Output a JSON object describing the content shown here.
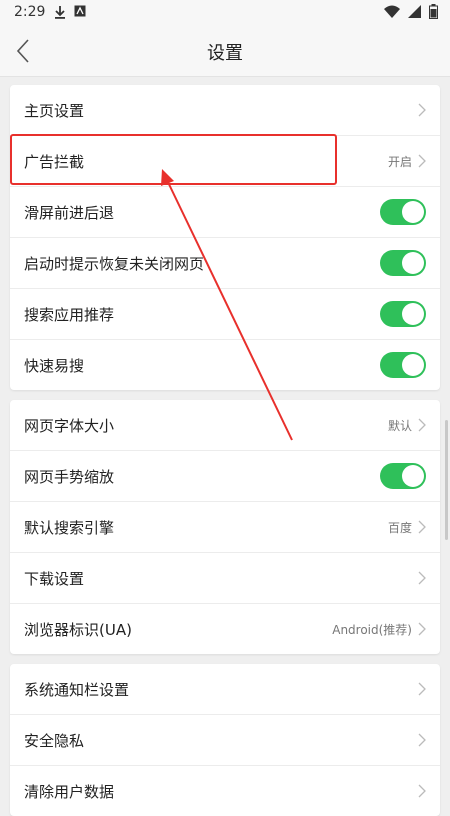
{
  "status_bar": {
    "time": "2:29",
    "left_icons": [
      "download-icon",
      "app-notification-icon"
    ],
    "right_icons": [
      "wifi-icon",
      "signal-icon",
      "battery-icon"
    ]
  },
  "header": {
    "title": "设置",
    "back_icon": "chevron-left-icon"
  },
  "sections": [
    {
      "rows": [
        {
          "name": "homepage-settings",
          "label": "主页设置",
          "type": "link",
          "value": ""
        },
        {
          "name": "ad-block",
          "label": "广告拦截",
          "type": "link",
          "value": "开启"
        },
        {
          "name": "swipe-back-forward",
          "label": "滑屏前进后退",
          "type": "toggle",
          "value": ""
        },
        {
          "name": "restore-pages-prompt",
          "label": "启动时提示恢复未关闭网页",
          "type": "toggle",
          "value": ""
        },
        {
          "name": "search-app-recommend",
          "label": "搜索应用推荐",
          "type": "toggle",
          "value": ""
        },
        {
          "name": "quick-search",
          "label": "快速易搜",
          "type": "toggle",
          "value": ""
        }
      ]
    },
    {
      "rows": [
        {
          "name": "font-size",
          "label": "网页字体大小",
          "type": "link",
          "value": "默认"
        },
        {
          "name": "gesture-zoom",
          "label": "网页手势缩放",
          "type": "toggle",
          "value": ""
        },
        {
          "name": "default-search-engine",
          "label": "默认搜索引擎",
          "type": "link",
          "value": "百度"
        },
        {
          "name": "download-settings",
          "label": "下载设置",
          "type": "link",
          "value": ""
        },
        {
          "name": "user-agent",
          "label": "浏览器标识(UA)",
          "type": "link",
          "value": "Android(推荐)"
        }
      ]
    },
    {
      "rows": [
        {
          "name": "notification-bar-settings",
          "label": "系统通知栏设置",
          "type": "link",
          "value": ""
        },
        {
          "name": "privacy-security",
          "label": "安全隐私",
          "type": "link",
          "value": ""
        },
        {
          "name": "clear-user-data",
          "label": "清除用户数据",
          "type": "link",
          "value": ""
        }
      ]
    }
  ],
  "colors": {
    "toggle_on": "#2fc05a",
    "annotation_red": "#e8302c",
    "background": "#efefef"
  },
  "toggles_state": "on"
}
